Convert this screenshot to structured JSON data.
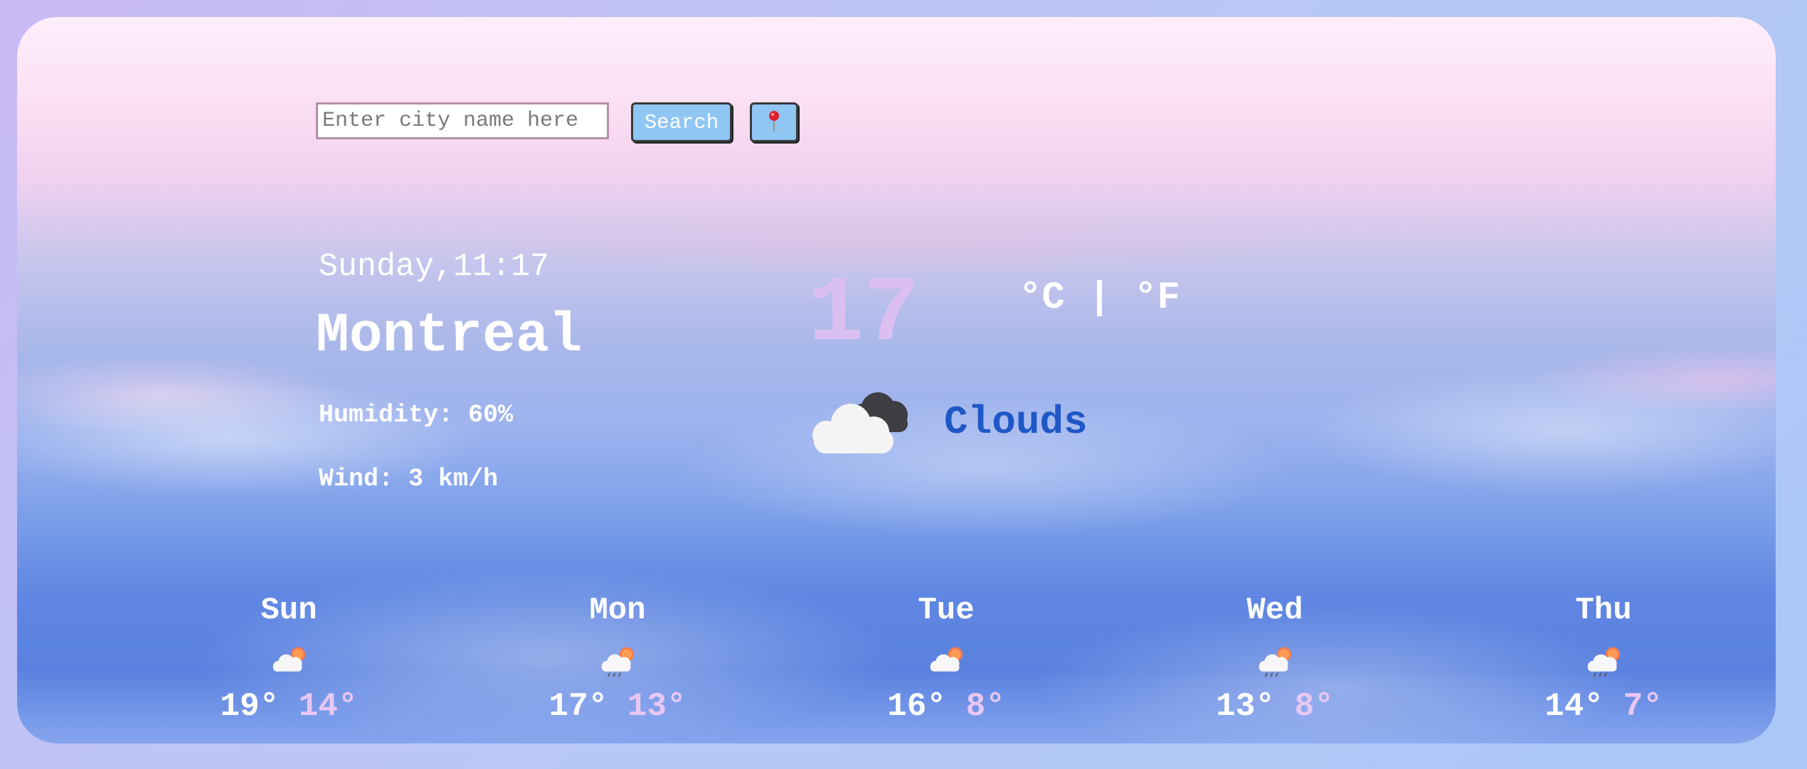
{
  "search": {
    "placeholder": "Enter city name here",
    "button_label": "Search",
    "location_icon": "pin-icon"
  },
  "current": {
    "datetime": "Sunday,11:17",
    "city": "Montreal",
    "humidity": "Humidity: 60%",
    "wind": "Wind: 3 km/h",
    "temperature": "17",
    "unit_c": "°C",
    "unit_sep": "|",
    "unit_f": "°F",
    "description": "Clouds",
    "icon": "clouds-icon"
  },
  "forecast": [
    {
      "day": "Sun",
      "max": "19°",
      "min": "14°",
      "icon": "partly-cloudy-icon"
    },
    {
      "day": "Mon",
      "max": "17°",
      "min": "13°",
      "icon": "rain-sun-icon"
    },
    {
      "day": "Tue",
      "max": "16°",
      "min": "8°",
      "icon": "partly-cloudy-icon"
    },
    {
      "day": "Wed",
      "max": "13°",
      "min": "8°",
      "icon": "rain-sun-icon"
    },
    {
      "day": "Thu",
      "max": "14°",
      "min": "7°",
      "icon": "rain-sun-icon"
    }
  ],
  "colors": {
    "accent_blue": "#8fc6f4",
    "description": "#1f57c6",
    "temperature": "#dcbff2",
    "min_temp": "#e8c7f3"
  }
}
